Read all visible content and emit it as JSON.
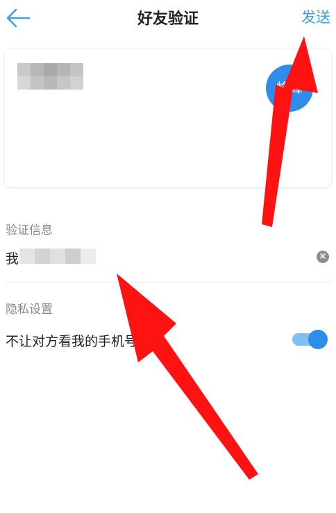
{
  "header": {
    "back_icon": "arrow-left-icon",
    "title": "好友验证",
    "send_label": "发送"
  },
  "card": {
    "avatar_text": "峰峰"
  },
  "verification": {
    "section_label": "验证信息",
    "value_prefix": "我",
    "clear_icon": "clear-circle-icon"
  },
  "privacy": {
    "section_label": "隐私设置",
    "option_label": "不让对方看我的手机号",
    "toggle_on": true
  },
  "colors": {
    "accent": "#3aa0ec",
    "toggle_knob": "#2d8ee8",
    "toggle_track": "#7fc0f2",
    "avatar_bg": "#2f8cea",
    "annotation_red": "#ff1212"
  }
}
